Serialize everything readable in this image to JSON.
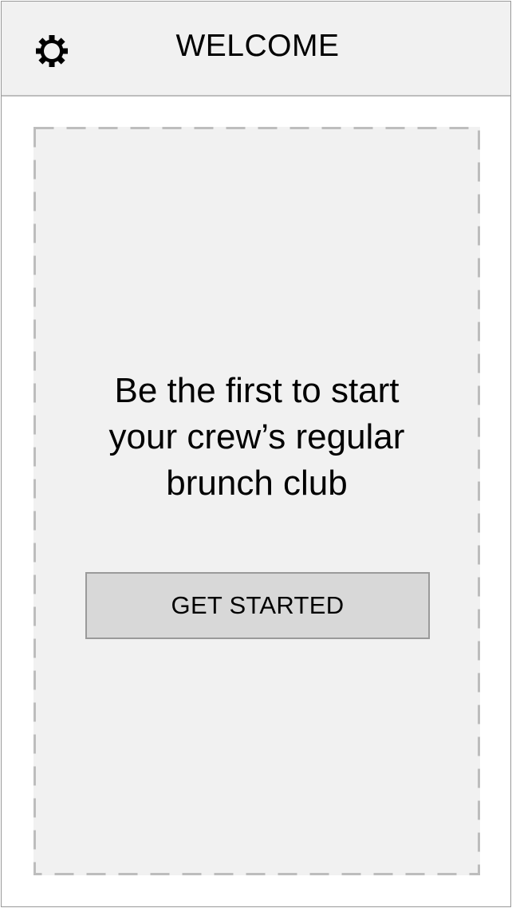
{
  "header": {
    "title": "WELCOME",
    "settings_icon": "gear-icon"
  },
  "main": {
    "headline_lines": [
      "Be the first to start",
      "your crew’s regular",
      "brunch club"
    ],
    "cta_label": "GET STARTED"
  },
  "colors": {
    "header_bg": "#f1f1f1",
    "content_bg": "#f1f1f1",
    "button_bg": "#d8d8d8",
    "border": "#9a9a9a",
    "dash": "#bdbdbd",
    "text": "#000000"
  }
}
